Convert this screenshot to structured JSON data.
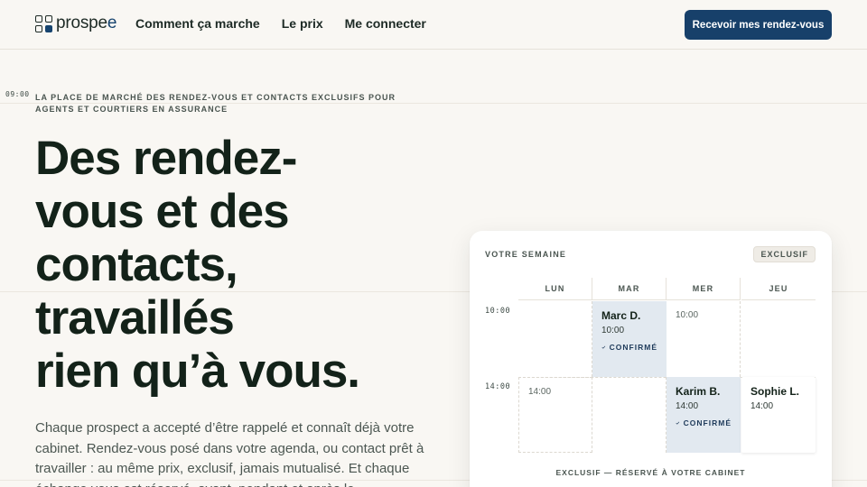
{
  "header": {
    "logo_text": "prospe",
    "logo_accent": "e",
    "nav": [
      "Comment ça marche",
      "Le prix",
      "Me connecter"
    ],
    "cta_label": "Recevoir mes rendez-vous"
  },
  "hero": {
    "time_marker": "09:00",
    "eyebrow": "La place de marché des rendez-vous et contacts exclusifs pour agents et courtiers en assurance",
    "headline": "Des rendez-\nvous et des\ncontacts,\ntravaillés\nrien qu’à vous.",
    "lead": "Chaque prospect a accepté d’être rappelé et connaît déjà votre cabinet. Rendez-vous posé dans votre agenda, ou contact prêt à travailler : au même prix, exclusif, jamais mutualisé. Et chaque échange vous est réservé, avant, pendant et après le"
  },
  "calendar": {
    "title": "VOTRE SEMAINE",
    "badge": "EXCLUSIF",
    "days": [
      "LUN",
      "MAR",
      "MER",
      "JEU"
    ],
    "times": [
      "10:00",
      "14:00"
    ],
    "appointments": [
      {
        "name": "Marc D.",
        "time": "10:00",
        "status": "CONFIRMÉ"
      },
      {
        "name": "Karim B.",
        "time": "14:00",
        "status": "CONFIRMÉ"
      },
      {
        "name": "Sophie L.",
        "time": "14:00"
      }
    ],
    "open_slots": [
      "10:00",
      "14:00"
    ],
    "footer": "EXCLUSIF — RÉSERVÉ À VOTRE CABINET"
  },
  "colors": {
    "background": "#f9f7f3",
    "primary": "#17406a",
    "booked_slot": "#e2e9f0"
  },
  "icons": [
    "logo-grid-icon",
    "check-icon"
  ]
}
